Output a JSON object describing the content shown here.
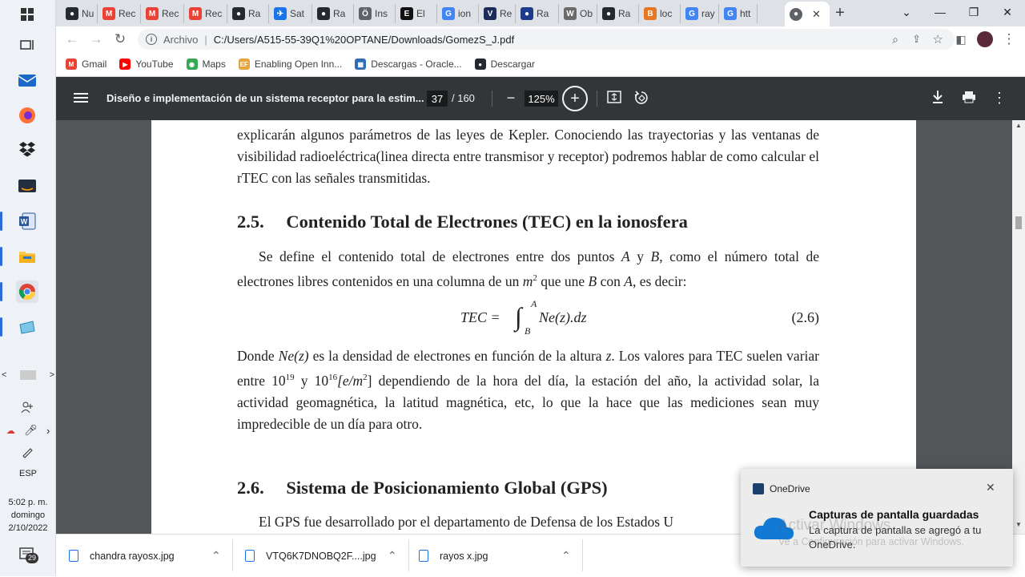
{
  "taskbar": {
    "time": "5:02 p. m.",
    "day": "domingo",
    "date": "2/10/2022",
    "lang": "ESP",
    "notif_count": "29"
  },
  "browser": {
    "tabs": [
      {
        "label": "Nu",
        "icon": "github-icon",
        "color": "#24292f",
        "glyph": "●"
      },
      {
        "label": "Rec",
        "icon": "gmail-icon",
        "color": "#ea4335",
        "glyph": "M"
      },
      {
        "label": "Rec",
        "icon": "gmail-icon",
        "color": "#ea4335",
        "glyph": "M"
      },
      {
        "label": "Rec",
        "icon": "gmail-icon",
        "color": "#ea4335",
        "glyph": "M"
      },
      {
        "label": "Ra",
        "icon": "github-icon",
        "color": "#24292f",
        "glyph": "●"
      },
      {
        "label": "Sat",
        "icon": "satellite-icon",
        "color": "#1a73e8",
        "glyph": "✈"
      },
      {
        "label": "Ra",
        "icon": "github-icon",
        "color": "#24292f",
        "glyph": "●"
      },
      {
        "label": "Ins",
        "icon": "instrument-icon",
        "color": "#5f6368",
        "glyph": "Ö"
      },
      {
        "label": "El",
        "icon": "e-icon",
        "color": "#111111",
        "glyph": "E"
      },
      {
        "label": "ion",
        "icon": "google-icon",
        "color": "#4285f4",
        "glyph": "G"
      },
      {
        "label": "Re",
        "icon": "v-icon",
        "color": "#1c2c5b",
        "glyph": "V"
      },
      {
        "label": "Ra",
        "icon": "nasa-icon",
        "color": "#1e3a8a",
        "glyph": "●"
      },
      {
        "label": "Ob",
        "icon": "wikipedia-icon",
        "color": "#6b6b6b",
        "glyph": "W"
      },
      {
        "label": "Ra",
        "icon": "github-icon",
        "color": "#24292f",
        "glyph": "●"
      },
      {
        "label": "loc",
        "icon": "b-icon",
        "color": "#e87722",
        "glyph": "B"
      },
      {
        "label": "ray",
        "icon": "google-icon",
        "color": "#4285f4",
        "glyph": "G"
      },
      {
        "label": "htt",
        "icon": "google-icon",
        "color": "#4285f4",
        "glyph": "G"
      }
    ],
    "active_tab_close": "✕",
    "new_tab": "+",
    "address_label": "Archivo",
    "address_url": "C:/Users/A515-55-39Q1%20OPTANE/Downloads/GomezS_J.pdf",
    "bookmarks": [
      {
        "label": "Gmail",
        "icon": "gmail-icon",
        "color": "#ea4335",
        "glyph": "M"
      },
      {
        "label": "YouTube",
        "icon": "youtube-icon",
        "color": "#ff0000",
        "glyph": "▶"
      },
      {
        "label": "Maps",
        "icon": "maps-icon",
        "color": "#34a853",
        "glyph": "◉"
      },
      {
        "label": "Enabling Open Inn...",
        "icon": "ef-icon",
        "color": "#e8a33d",
        "glyph": "EF"
      },
      {
        "label": "Descargas - Oracle...",
        "icon": "oracle-icon",
        "color": "#2f6db5",
        "glyph": "▦"
      },
      {
        "label": "Descargar",
        "icon": "github-icon",
        "color": "#24292f",
        "glyph": "●"
      }
    ]
  },
  "pdf": {
    "title": "Diseño e implementación de un sistema receptor para la estim...",
    "page_current": "37",
    "page_total": "/ 160",
    "zoom": "125%",
    "body": {
      "p1": "explicarán algunos parámetros de las leyes de Kepler. Conociendo las trayectorias y las ventanas de visibilidad radioeléctrica(linea directa entre transmisor y receptor) podremos hablar de como calcular el rTEC con las señales transmitidas.",
      "h25_num": "2.5.",
      "h25_text": "Contenido Total de Electrones (TEC) en la ionosfera",
      "p2a": "Se define el contenido total de electrones entre dos puntos ",
      "p2_A": "A",
      "p2b": " y ",
      "p2_B": "B",
      "p2c": ", como el número total de electrones libres contenidos en una columna de un ",
      "p2_m": "m",
      "p2_exp": "2",
      "p2d": " que une ",
      "p2_B2": "B",
      "p2e": " con ",
      "p2_A2": "A",
      "p2f": ", es decir:",
      "eq_lhs": "TEC =",
      "eq_upper": "A",
      "eq_lower": "B",
      "eq_rhs": "Ne(z).dz",
      "eq_num": "(2.6)",
      "p3a": "Donde ",
      "p3_ne": "Ne(z)",
      "p3b": " es la densidad de electrones en función de la altura ",
      "p3_z": "z",
      "p3c": ". Los valores para TEC suelen variar entre 10",
      "p3_e1": "19",
      "p3d": " y 10",
      "p3_e2": "16",
      "p3_unit": "[e/m",
      "p3_unit_exp": "2",
      "p3_close": "]",
      "p3e": " dependiendo de la hora del día, la estación del año, la actividad solar, la actividad geomagnética, la latitud magnética, etc, lo que la hace que las mediciones sean muy impredecible de un día para otro.",
      "h26_num": "2.6.",
      "h26_text": "Sistema de Posicionamiento Global (GPS)",
      "p4": "El GPS fue desarrollado por el departamento de Defensa de los Estados U"
    }
  },
  "downloads": [
    {
      "name": "chandra rayosx.jpg"
    },
    {
      "name": "VTQ6K7DNOBQ2F....jpg"
    },
    {
      "name": "rayos x.jpg"
    }
  ],
  "toast": {
    "app": "OneDrive",
    "title": "Capturas de pantalla guardadas",
    "body": "La captura de pantalla se agregó a tu OneDrive.",
    "watermark1": "Activar Windows",
    "watermark2": "Ve a Configuración para activar Windows."
  }
}
